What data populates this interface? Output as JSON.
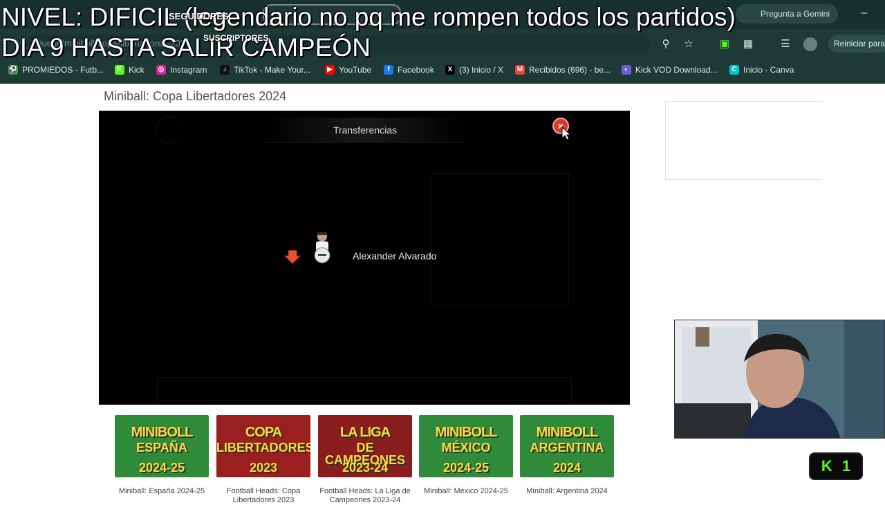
{
  "stream_overlay": {
    "line1": "NIVEL: DIFICIL (legendario no pq me rompen todos los partidos)",
    "line2": "DIA 9 HASTA SALIR CAMPEÓN",
    "followers_label": "SEGUIDORES",
    "subs_label": "SUSCRIPTORES"
  },
  "browser": {
    "gemini_label": "Pregunta a Gemini",
    "restart_label": "Reiniciar para",
    "url": "/juego/miniball-copa-libertadores-2024",
    "minimize": "–"
  },
  "bookmarks": [
    {
      "label": "PROMIEDOS - Futb...",
      "icon": "promiedos-icon",
      "color": "#2f9e44",
      "glyph": "⚽"
    },
    {
      "label": "Kick",
      "icon": "kick-icon",
      "color": "#53fc18",
      "glyph": "K"
    },
    {
      "label": "Instagram",
      "icon": "instagram-icon",
      "color": "#d6249f",
      "glyph": "◎"
    },
    {
      "label": "TikTok - Make Your...",
      "icon": "tiktok-icon",
      "color": "#111111",
      "glyph": "♪"
    },
    {
      "label": "YouTube",
      "icon": "youtube-icon",
      "color": "#ff0000",
      "glyph": "▶"
    },
    {
      "label": "Facebook",
      "icon": "facebook-icon",
      "color": "#1877f2",
      "glyph": "f"
    },
    {
      "label": "(3) Inicio / X",
      "icon": "x-icon",
      "color": "#000000",
      "glyph": "X"
    },
    {
      "label": "Recibidos (696) - be...",
      "icon": "gmail-icon",
      "color": "#ea4335",
      "glyph": "M"
    },
    {
      "label": "Kick VOD Download...",
      "icon": "kick-vod-icon",
      "color": "#6e5bd6",
      "glyph": "◐"
    },
    {
      "label": "Inicio - Canva",
      "icon": "canva-icon",
      "color": "#00c4cc",
      "glyph": "C"
    }
  ],
  "page": {
    "title": "Miniball: Copa Libertadores 2024"
  },
  "game": {
    "header": "Transferencias",
    "close_glyph": "×",
    "player_name": "Alexander Alvarado"
  },
  "thumbnails": [
    {
      "caption": "Miniball: España 2024-25",
      "line1": "MINIBOLL",
      "line2": "ESPAÑA",
      "line3": "2024-25",
      "bg": "#2f8a3a"
    },
    {
      "caption": "Football Heads: Copa Libertadores 2023",
      "line1": "COPA",
      "line2": "LIBERTADORES",
      "line3": "2023",
      "bg": "#9b1f1f"
    },
    {
      "caption": "Football Heads: La Liga de Campeones 2023-24",
      "line1": "LA LIGA",
      "line2": "DE CAMPEONES",
      "line3": "2023-24",
      "bg": "#8a1d1d"
    },
    {
      "caption": "Miniball: México 2024-25",
      "line1": "MINIBOLL",
      "line2": "MÉXICO",
      "line3": "2024-25",
      "bg": "#2f8a3a"
    },
    {
      "caption": "Miniball: Argentina 2024",
      "line1": "MINIBOLL",
      "line2": "ARGENTINA",
      "line3": "2024",
      "bg": "#2f8a3a"
    }
  ],
  "kick_badge": {
    "glyph": "K",
    "count": "1"
  }
}
